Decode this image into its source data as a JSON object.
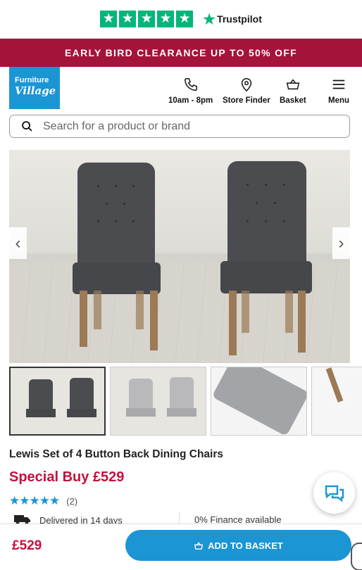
{
  "trustbar": {
    "brand": "Trustpilot",
    "icon": "trustpilot-star-icon",
    "stars": [
      "★",
      "★",
      "★",
      "★",
      "★"
    ],
    "accent": "#00b67a"
  },
  "promo": {
    "text": "EARLY BIRD CLEARANCE UP TO 50% OFF",
    "color": "#a3133a"
  },
  "header": {
    "logo": {
      "line1": "Furniture",
      "line2": "Village"
    },
    "nav": [
      {
        "label": "10am - 8pm",
        "icon": "phone-icon"
      },
      {
        "label": "Store Finder",
        "icon": "location-pin-icon"
      },
      {
        "label": "Basket",
        "icon": "basket-icon"
      },
      {
        "label": "Menu",
        "icon": "hamburger-menu-icon"
      }
    ]
  },
  "search": {
    "placeholder": "Search for a product or brand",
    "icon": "search-icon"
  },
  "gallery": {
    "prev": "‹",
    "next": "›",
    "thumbnails": [
      "dark-grey-chairs-thumbnail",
      "light-grey-chairs-thumbnail",
      "seat-detail-thumbnail",
      "leg-detail-thumbnail"
    ]
  },
  "product": {
    "title": "Lewis Set of 4 Button Back Dining Chairs",
    "price_label": "Special Buy £529",
    "rating_stars": "★★★★★",
    "rating_count": "(2)",
    "delivery": "Delivered in 14 days",
    "finance": "0% Finance available"
  },
  "bottom_bar": {
    "price": "£529",
    "button_label": "ADD TO BASKET",
    "brand_blue": "#1b95d4",
    "price_red": "#c4113e"
  },
  "chat": {
    "icon": "chat-bubbles-icon"
  }
}
